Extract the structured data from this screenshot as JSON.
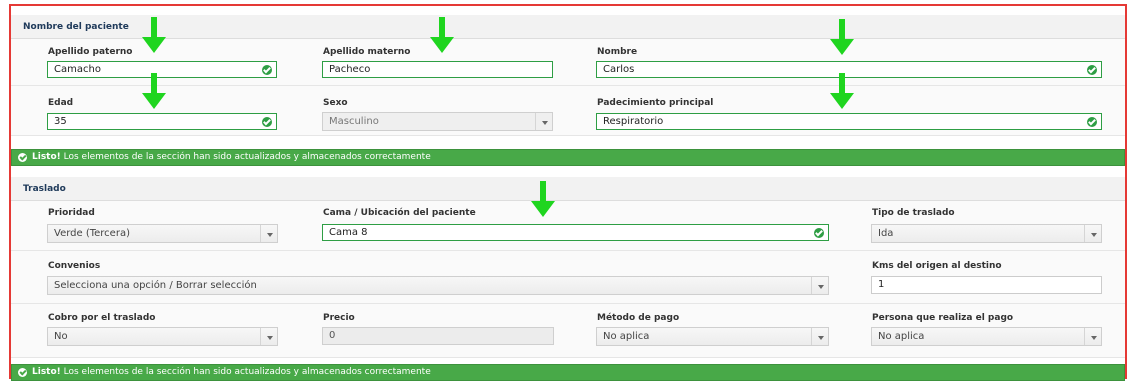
{
  "colors": {
    "accent_green": "#2e9e44",
    "banner_green": "#48a948",
    "frame_red": "#e53935",
    "arrow_green": "#1fd51f"
  },
  "patient": {
    "header": "Nombre del paciente",
    "apellido_paterno": {
      "label": "Apellido paterno",
      "value": "Camacho"
    },
    "apellido_materno": {
      "label": "Apellido materno",
      "value": "Pacheco"
    },
    "nombre": {
      "label": "Nombre",
      "value": "Carlos"
    },
    "edad": {
      "label": "Edad",
      "value": "35"
    },
    "sexo": {
      "label": "Sexo",
      "value": "Masculino"
    },
    "padecimiento": {
      "label": "Padecimiento principal",
      "value": "Respiratorio"
    }
  },
  "banner1": {
    "strong": "Listo!",
    "text": " Los elementos de la sección han sido actualizados y almacenados correctamente"
  },
  "transfer": {
    "header": "Traslado",
    "prioridad": {
      "label": "Prioridad",
      "value": "Verde (Tercera)"
    },
    "cama": {
      "label": "Cama / Ubicación del paciente",
      "value": "Cama 8"
    },
    "tipo": {
      "label": "Tipo de traslado",
      "value": "Ida"
    },
    "convenios": {
      "label": "Convenios",
      "value": "Selecciona una opción / Borrar selección"
    },
    "kms": {
      "label": "Kms del origen al destino",
      "value": "1"
    },
    "cobro": {
      "label": "Cobro por el traslado",
      "value": "No"
    },
    "precio": {
      "label": "Precio",
      "value": "0"
    },
    "metodo": {
      "label": "Método de pago",
      "value": "No aplica"
    },
    "persona": {
      "label": "Persona que realiza el pago",
      "value": "No aplica"
    }
  },
  "banner2": {
    "strong": "Listo!",
    "text": " Los elementos de la sección han sido actualizados y almacenados correctamente"
  }
}
